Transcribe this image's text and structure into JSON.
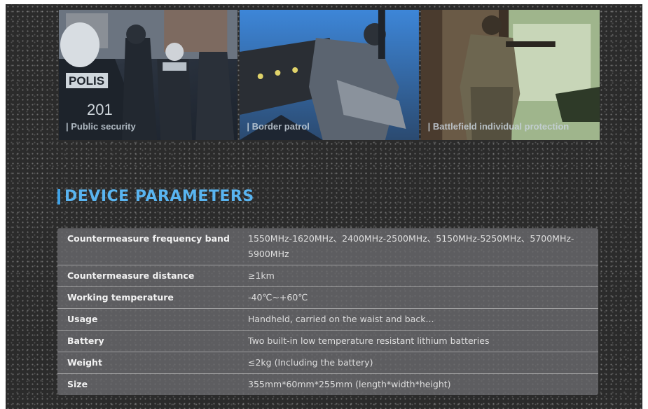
{
  "banner": {
    "images": [
      {
        "caption": "| Public security"
      },
      {
        "caption": "| Border patrol"
      },
      {
        "caption": "| Battlefield individual protection"
      }
    ]
  },
  "section": {
    "title": "DEVICE PARAMETERS"
  },
  "parameters": [
    {
      "label": "Countermeasure frequency band",
      "value": "1550MHz-1620MHz、2400MHz-2500MHz、5150MHz-5250MHz、5700MHz-5900MHz"
    },
    {
      "label": "Countermeasure distance",
      "value": "≥1km"
    },
    {
      "label": "Working temperature",
      "value": "-40℃~+60℃"
    },
    {
      "label": "Usage",
      "value": "Handheld, carried on the waist and back..."
    },
    {
      "label": "Battery",
      "value": "Two built-in low temperature resistant lithium batteries"
    },
    {
      "label": "Weight",
      "value": "≤2kg (Including the battery)"
    },
    {
      "label": "Size",
      "value": "355mm*60mm*255mm (length*width*height)"
    }
  ],
  "colors": {
    "accent": "#59b4f0",
    "background": "#2b2b2b",
    "table": "#69696c"
  }
}
